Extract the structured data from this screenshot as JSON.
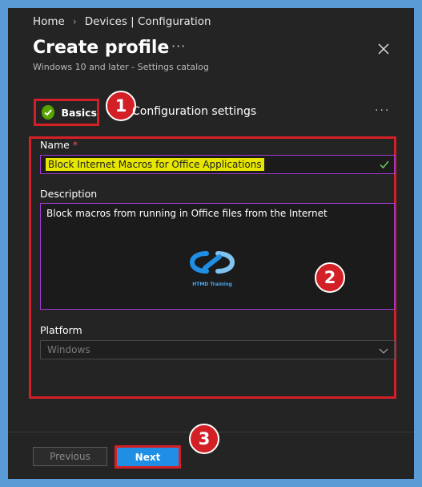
{
  "breadcrumb": {
    "home": "Home",
    "separator": "›",
    "current": "Devices | Configuration"
  },
  "header": {
    "title": "Create profile",
    "more": "···",
    "subtitle": "Windows 10 and later - Settings catalog"
  },
  "steps": {
    "basics": "Basics",
    "configuration": "Configuration settings",
    "more": "···"
  },
  "form": {
    "name_label": "Name",
    "required_mark": "*",
    "name_value": "Block Internet Macros for Office Applications",
    "description_label": "Description",
    "description_value": "Block macros from running in Office files from the Internet",
    "platform_label": "Platform",
    "platform_value": "Windows"
  },
  "logo": {
    "text": "HTMD Training"
  },
  "callouts": {
    "one": "1",
    "two": "2",
    "three": "3"
  },
  "footer": {
    "previous": "Previous",
    "next": "Next"
  },
  "colors": {
    "background": "#5b9bd5",
    "panel": "#242424",
    "annotation_red": "#d31f26",
    "accent_blue": "#1f8fe6",
    "success_green": "#57a300",
    "input_border": "#a23ad4"
  }
}
